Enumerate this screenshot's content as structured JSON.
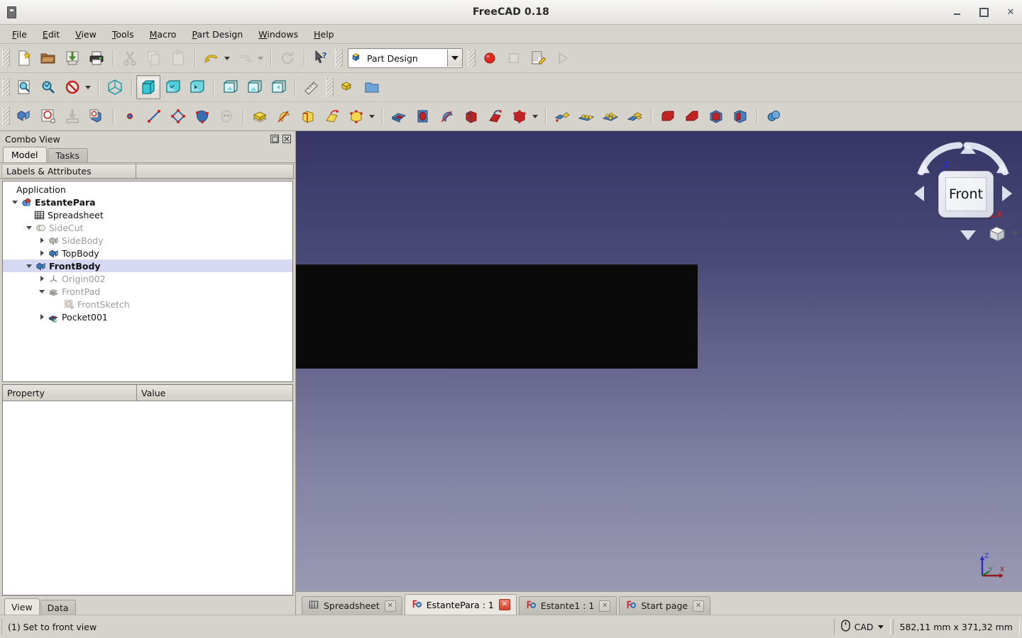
{
  "window": {
    "title": "FreeCAD 0.18",
    "app_icon": "freecad-app-icon",
    "minimize": "–",
    "maximize": "□",
    "close": "✕"
  },
  "menubar": {
    "items": [
      {
        "label": "File",
        "mnemonic": "F"
      },
      {
        "label": "Edit",
        "mnemonic": "E"
      },
      {
        "label": "View",
        "mnemonic": "V"
      },
      {
        "label": "Tools",
        "mnemonic": "T"
      },
      {
        "label": "Macro",
        "mnemonic": "M"
      },
      {
        "label": "Part Design",
        "mnemonic": "P"
      },
      {
        "label": "Windows",
        "mnemonic": "W"
      },
      {
        "label": "Help",
        "mnemonic": "H"
      }
    ]
  },
  "toolbars": {
    "file": [
      {
        "name": "new-document-button",
        "tooltip": "New"
      },
      {
        "name": "open-document-button",
        "tooltip": "Open"
      },
      {
        "name": "save-document-button",
        "tooltip": "Save"
      },
      {
        "name": "print-button",
        "tooltip": "Print"
      },
      {
        "name": "cut-button",
        "tooltip": "Cut"
      },
      {
        "name": "copy-button",
        "tooltip": "Copy"
      },
      {
        "name": "paste-button",
        "tooltip": "Paste"
      },
      {
        "name": "undo-button",
        "tooltip": "Undo"
      },
      {
        "name": "redo-button",
        "tooltip": "Redo"
      },
      {
        "name": "refresh-button",
        "tooltip": "Refresh"
      },
      {
        "name": "whats-this-button",
        "tooltip": "What's This"
      }
    ],
    "workbench": {
      "selected": "Part Design",
      "icon": "part-design-icon"
    },
    "macro": [
      {
        "name": "macro-record-button",
        "tooltip": "Macro recording"
      },
      {
        "name": "macro-stop-button",
        "tooltip": "Stop macro recording"
      },
      {
        "name": "macro-edit-button",
        "tooltip": "Macros"
      },
      {
        "name": "macro-execute-button",
        "tooltip": "Execute macro"
      }
    ],
    "view": [
      {
        "name": "fit-all-button",
        "tooltip": "Fits the whole content on the screen"
      },
      {
        "name": "fit-selection-button",
        "tooltip": "Fit selection"
      },
      {
        "name": "draw-style-button",
        "tooltip": "Draw style"
      },
      {
        "name": "axonometric-view-button",
        "tooltip": "Isometric"
      },
      {
        "name": "front-view-button",
        "tooltip": "Front",
        "active": true
      },
      {
        "name": "top-view-button",
        "tooltip": "Top"
      },
      {
        "name": "right-view-button",
        "tooltip": "Right"
      },
      {
        "name": "rear-view-button",
        "tooltip": "Rear"
      },
      {
        "name": "bottom-view-button",
        "tooltip": "Bottom"
      },
      {
        "name": "left-view-button",
        "tooltip": "Left"
      },
      {
        "name": "measure-button",
        "tooltip": "Measure"
      },
      {
        "name": "create-part-button",
        "tooltip": "Create part"
      },
      {
        "name": "create-group-button",
        "tooltip": "Create group"
      }
    ],
    "partdesign": [
      {
        "name": "create-body-button",
        "tooltip": "Create body"
      },
      {
        "name": "create-sketch-button",
        "tooltip": "Create sketch"
      },
      {
        "name": "edit-sketch-button",
        "tooltip": "Edit sketch"
      },
      {
        "name": "map-sketch-button",
        "tooltip": "Map sketch to face"
      },
      {
        "name": "create-point-button",
        "tooltip": "Create a datum point"
      },
      {
        "name": "create-line-button",
        "tooltip": "Create a datum line"
      },
      {
        "name": "create-plane-button",
        "tooltip": "Create a datum plane"
      },
      {
        "name": "shape-binder-button",
        "tooltip": "Create a shape binder"
      },
      {
        "name": "sub-object-binder-button",
        "tooltip": "Create a sub-object shape binder"
      }
    ],
    "additive": [
      {
        "name": "pad-button",
        "tooltip": "Pad"
      },
      {
        "name": "revolution-button",
        "tooltip": "Revolution"
      },
      {
        "name": "additive-loft-button",
        "tooltip": "Additive loft"
      },
      {
        "name": "additive-pipe-button",
        "tooltip": "Additive pipe"
      },
      {
        "name": "additive-primitive-button",
        "tooltip": "Create an additive primitive"
      }
    ],
    "subtractive": [
      {
        "name": "pocket-button",
        "tooltip": "Pocket"
      },
      {
        "name": "hole-button",
        "tooltip": "Hole"
      },
      {
        "name": "groove-button",
        "tooltip": "Groove"
      },
      {
        "name": "subtractive-loft-button",
        "tooltip": "Subtractive loft"
      },
      {
        "name": "subtractive-pipe-button",
        "tooltip": "Subtractive pipe"
      },
      {
        "name": "subtractive-primitive-button",
        "tooltip": "Create a subtractive primitive"
      }
    ],
    "transform": [
      {
        "name": "mirrored-button",
        "tooltip": "Mirrored"
      },
      {
        "name": "linear-pattern-button",
        "tooltip": "LinearPattern"
      },
      {
        "name": "polar-pattern-button",
        "tooltip": "PolarPattern"
      },
      {
        "name": "multi-transform-button",
        "tooltip": "Create MultiTransform"
      }
    ],
    "dressup": [
      {
        "name": "fillet-button",
        "tooltip": "Fillet"
      },
      {
        "name": "chamfer-button",
        "tooltip": "Chamfer"
      },
      {
        "name": "draft-button",
        "tooltip": "Draft"
      },
      {
        "name": "thickness-button",
        "tooltip": "Thickness"
      },
      {
        "name": "boolean-button",
        "tooltip": "Boolean operation"
      }
    ]
  },
  "combo_view": {
    "title": "Combo View",
    "float_icon": "float-panel-icon",
    "close_icon": "close-panel-icon",
    "tabs": [
      {
        "label": "Model",
        "active": true
      },
      {
        "label": "Tasks",
        "active": false
      }
    ],
    "tree_header": {
      "labels_attributes": "Labels & Attributes",
      "description": ""
    },
    "tree": [
      {
        "label": "Application",
        "depth": 0,
        "expander": "none",
        "icon": "none",
        "bold": false,
        "dim": false,
        "selected": false
      },
      {
        "label": "EstantePara",
        "depth": 1,
        "expander": "open",
        "icon": "document-icon",
        "bold": true,
        "dim": false,
        "selected": false
      },
      {
        "label": "Spreadsheet",
        "depth": 2,
        "expander": "none",
        "icon": "spreadsheet-icon",
        "bold": false,
        "dim": false,
        "selected": false
      },
      {
        "label": "SideCut",
        "depth": 2,
        "expander": "open",
        "icon": "boolean-cut-icon",
        "bold": false,
        "dim": true,
        "selected": false
      },
      {
        "label": "SideBody",
        "depth": 3,
        "expander": "closed",
        "icon": "body-icon",
        "bold": false,
        "dim": true,
        "selected": false
      },
      {
        "label": "TopBody",
        "depth": 3,
        "expander": "closed",
        "icon": "body-icon",
        "bold": false,
        "dim": false,
        "selected": false
      },
      {
        "label": "FrontBody",
        "depth": 2,
        "expander": "open",
        "icon": "body-icon",
        "bold": true,
        "dim": false,
        "selected": true
      },
      {
        "label": "Origin002",
        "depth": 3,
        "expander": "closed",
        "icon": "origin-icon",
        "bold": false,
        "dim": true,
        "selected": false
      },
      {
        "label": "FrontPad",
        "depth": 3,
        "expander": "open",
        "icon": "pad-icon",
        "bold": false,
        "dim": true,
        "selected": false
      },
      {
        "label": "FrontSketch",
        "depth": 4,
        "expander": "none",
        "icon": "sketch-icon",
        "bold": false,
        "dim": true,
        "selected": false
      },
      {
        "label": "Pocket001",
        "depth": 3,
        "expander": "closed",
        "icon": "pocket-icon",
        "bold": false,
        "dim": false,
        "selected": false
      }
    ],
    "property_header": {
      "property": "Property",
      "value": "Value"
    },
    "property_rows": [],
    "bottom_tabs": [
      {
        "label": "View",
        "active": true
      },
      {
        "label": "Data",
        "active": false
      }
    ]
  },
  "viewport": {
    "nav_cube": {
      "face_label": "Front",
      "axis_z": "Z",
      "axis_x": "X",
      "up_arrow": "nav-arrow-up",
      "down_arrow": "nav-arrow-down",
      "left_arrow": "nav-arrow-left",
      "right_arrow": "nav-arrow-right"
    },
    "axis_cross": {
      "x": "X",
      "y": "Y",
      "z": "Z"
    },
    "background_top": "#363566",
    "background_bottom": "#9a9ab4",
    "model_color": "#0a0a0a"
  },
  "document_tabs": [
    {
      "label": "Spreadsheet",
      "icon": "spreadsheet-icon",
      "active": false,
      "close": "✕"
    },
    {
      "label": "EstantePara : 1",
      "icon": "freecad-doc-icon",
      "active": true,
      "close": "✕"
    },
    {
      "label": "Estante1 : 1",
      "icon": "freecad-doc-icon",
      "active": false,
      "close": "✕"
    },
    {
      "label": "Start page",
      "icon": "freecad-doc-icon",
      "active": false,
      "close": "✕"
    }
  ],
  "statusbar": {
    "message": "(1) Set to front view",
    "navigation_mode": "CAD",
    "navigation_icon": "mouse-icon",
    "dimensions": "582,11 mm x 371,32 mm"
  }
}
